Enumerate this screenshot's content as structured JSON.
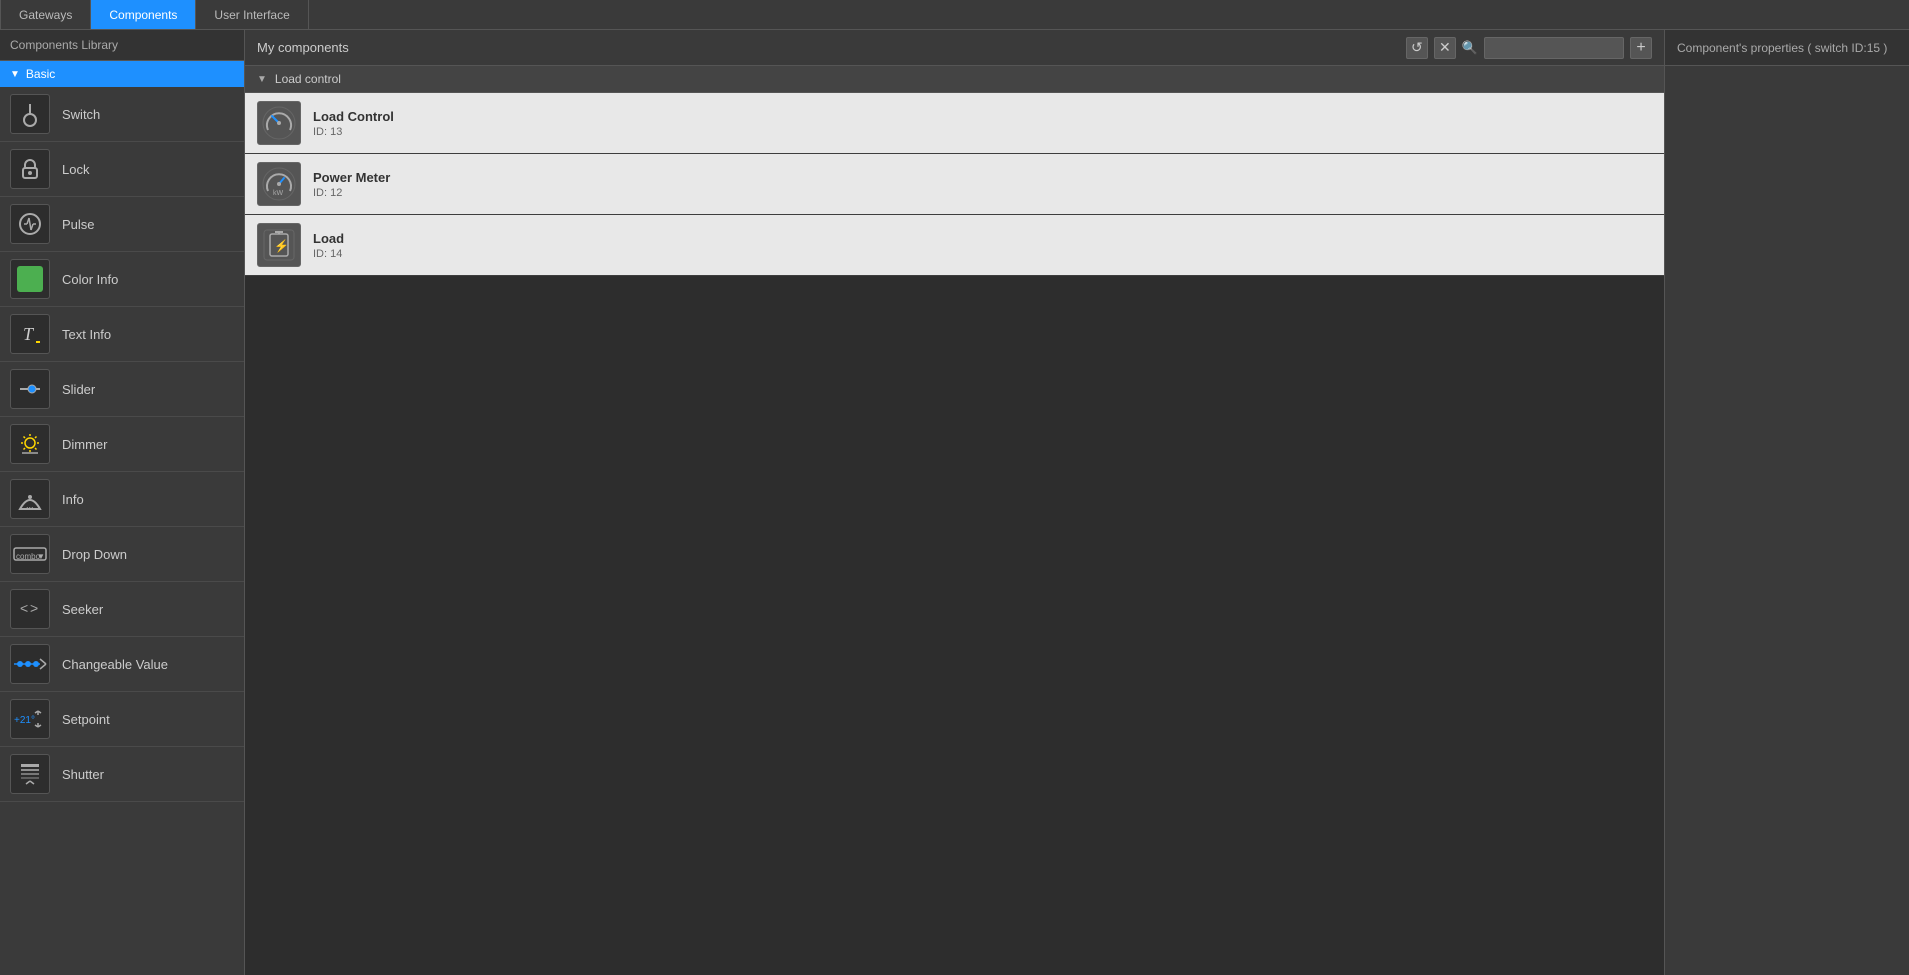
{
  "nav": {
    "tabs": [
      {
        "label": "Gateways",
        "active": false
      },
      {
        "label": "Components",
        "active": true
      },
      {
        "label": "User Interface",
        "active": false
      }
    ]
  },
  "sidebar": {
    "header": "Components Library",
    "section": "Basic",
    "items": [
      {
        "id": "switch",
        "label": "Switch",
        "icon": "switch"
      },
      {
        "id": "lock",
        "label": "Lock",
        "icon": "lock"
      },
      {
        "id": "pulse",
        "label": "Pulse",
        "icon": "pulse"
      },
      {
        "id": "color-info",
        "label": "Color Info",
        "icon": "color"
      },
      {
        "id": "text-info",
        "label": "Text Info",
        "icon": "text"
      },
      {
        "id": "slider",
        "label": "Slider",
        "icon": "slider"
      },
      {
        "id": "dimmer",
        "label": "Dimmer",
        "icon": "dimmer"
      },
      {
        "id": "info",
        "label": "Info",
        "icon": "info"
      },
      {
        "id": "dropdown",
        "label": "Drop Down",
        "icon": "dropdown"
      },
      {
        "id": "seeker",
        "label": "Seeker",
        "icon": "seeker"
      },
      {
        "id": "changeable-value",
        "label": "Changeable Value",
        "icon": "changeable"
      },
      {
        "id": "setpoint",
        "label": "Setpoint",
        "icon": "setpoint"
      },
      {
        "id": "shutter",
        "label": "Shutter",
        "icon": "shutter"
      }
    ]
  },
  "center": {
    "title": "My components",
    "search_placeholder": "",
    "groups": [
      {
        "name": "Load control",
        "collapsed": false,
        "items": [
          {
            "name": "Load Control",
            "id": "ID: 13",
            "icon": "gauge"
          },
          {
            "name": "Power Meter",
            "id": "ID: 12",
            "icon": "power-meter"
          },
          {
            "name": "Load",
            "id": "ID: 14",
            "icon": "load"
          }
        ]
      }
    ]
  },
  "right_panel": {
    "title": "Component's properties ( switch ID:15 )"
  },
  "icons": {
    "refresh": "↺",
    "close": "✕",
    "search": "🔍",
    "add": "+",
    "arrow_down": "▼",
    "arrow_right": "▶"
  }
}
